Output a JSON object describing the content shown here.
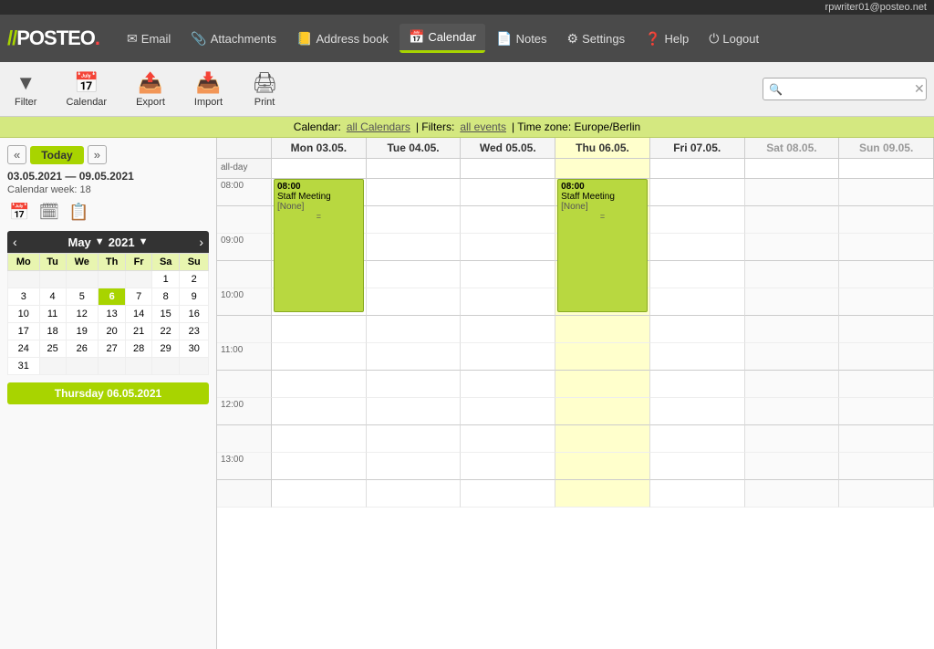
{
  "topbar": {
    "user_email": "rpwriter01@posteo.net"
  },
  "navbar": {
    "logo": "//POSTEO",
    "items": [
      {
        "id": "email",
        "label": "Email",
        "icon": "✉",
        "active": false
      },
      {
        "id": "attachments",
        "label": "Attachments",
        "icon": "📎",
        "active": false
      },
      {
        "id": "address-book",
        "label": "Address book",
        "icon": "📒",
        "active": false
      },
      {
        "id": "calendar",
        "label": "Calendar",
        "icon": "📅",
        "active": true
      },
      {
        "id": "notes",
        "label": "Notes",
        "icon": "📄",
        "active": false
      },
      {
        "id": "settings",
        "label": "Settings",
        "icon": "⚙",
        "active": false
      },
      {
        "id": "help",
        "label": "Help",
        "icon": "❓",
        "active": false
      },
      {
        "id": "logout",
        "label": "Logout",
        "icon": "⏻",
        "active": false
      }
    ]
  },
  "toolbar": {
    "filter_label": "Filter",
    "calendar_label": "Calendar",
    "export_label": "Export",
    "import_label": "Import",
    "print_label": "Print",
    "search_placeholder": "🔍"
  },
  "cal_infobar": {
    "text": "Calendar:",
    "all_calendars": "all Calendars",
    "filters_text": "| Filters:",
    "all_events": "all events",
    "timezone_text": "| Time zone: Europe/Berlin"
  },
  "week_nav": {
    "range": "03.05.2021 — 09.05.2021",
    "cal_week": "Calendar week: 18",
    "today_label": "Today"
  },
  "mini_calendar": {
    "month_label": "May",
    "year_label": "2021",
    "day_headers": [
      "Mo",
      "Tu",
      "We",
      "Th",
      "Fr",
      "Sa",
      "Su"
    ],
    "weeks": [
      [
        null,
        null,
        null,
        null,
        null,
        1,
        2
      ],
      [
        3,
        4,
        5,
        6,
        7,
        8,
        9
      ],
      [
        10,
        11,
        12,
        13,
        14,
        15,
        16
      ],
      [
        17,
        18,
        19,
        20,
        21,
        22,
        23
      ],
      [
        24,
        25,
        26,
        27,
        28,
        29,
        30
      ],
      [
        31,
        null,
        null,
        null,
        null,
        null,
        null
      ]
    ],
    "today_day": 6
  },
  "selected_date": "Thursday 06.05.2021",
  "day_headers": [
    {
      "label": "Mon 03.05.",
      "col_type": "normal"
    },
    {
      "label": "Tue 04.05.",
      "col_type": "normal"
    },
    {
      "label": "Wed 05.05.",
      "col_type": "normal"
    },
    {
      "label": "Thu 06.05.",
      "col_type": "today"
    },
    {
      "label": "Fri 07.05.",
      "col_type": "normal"
    },
    {
      "label": "Sat 08.05.",
      "col_type": "weekend"
    },
    {
      "label": "Sun 09.05.",
      "col_type": "weekend"
    }
  ],
  "allday_label": "all-day",
  "time_slots": [
    {
      "time": "08:00",
      "is_hour": true
    },
    {
      "time": "",
      "is_hour": false
    },
    {
      "time": "09:00",
      "is_hour": true
    },
    {
      "time": "",
      "is_hour": false
    },
    {
      "time": "10:00",
      "is_hour": true
    },
    {
      "time": "",
      "is_hour": false
    },
    {
      "time": "11:00",
      "is_hour": true
    },
    {
      "time": "",
      "is_hour": false
    },
    {
      "time": "12:00",
      "is_hour": true
    },
    {
      "time": "",
      "is_hour": false
    },
    {
      "time": "13:00",
      "is_hour": true
    },
    {
      "time": "",
      "is_hour": false
    }
  ],
  "events": [
    {
      "id": "evt1",
      "day_col": 0,
      "start_time": "08:00",
      "title": "Staff Meeting",
      "location": "[None]",
      "slot_start": 0,
      "slot_span": 5
    },
    {
      "id": "evt2",
      "day_col": 3,
      "start_time": "08:00",
      "title": "Staff Meeting",
      "location": "[None]",
      "slot_start": 0,
      "slot_span": 5
    }
  ]
}
